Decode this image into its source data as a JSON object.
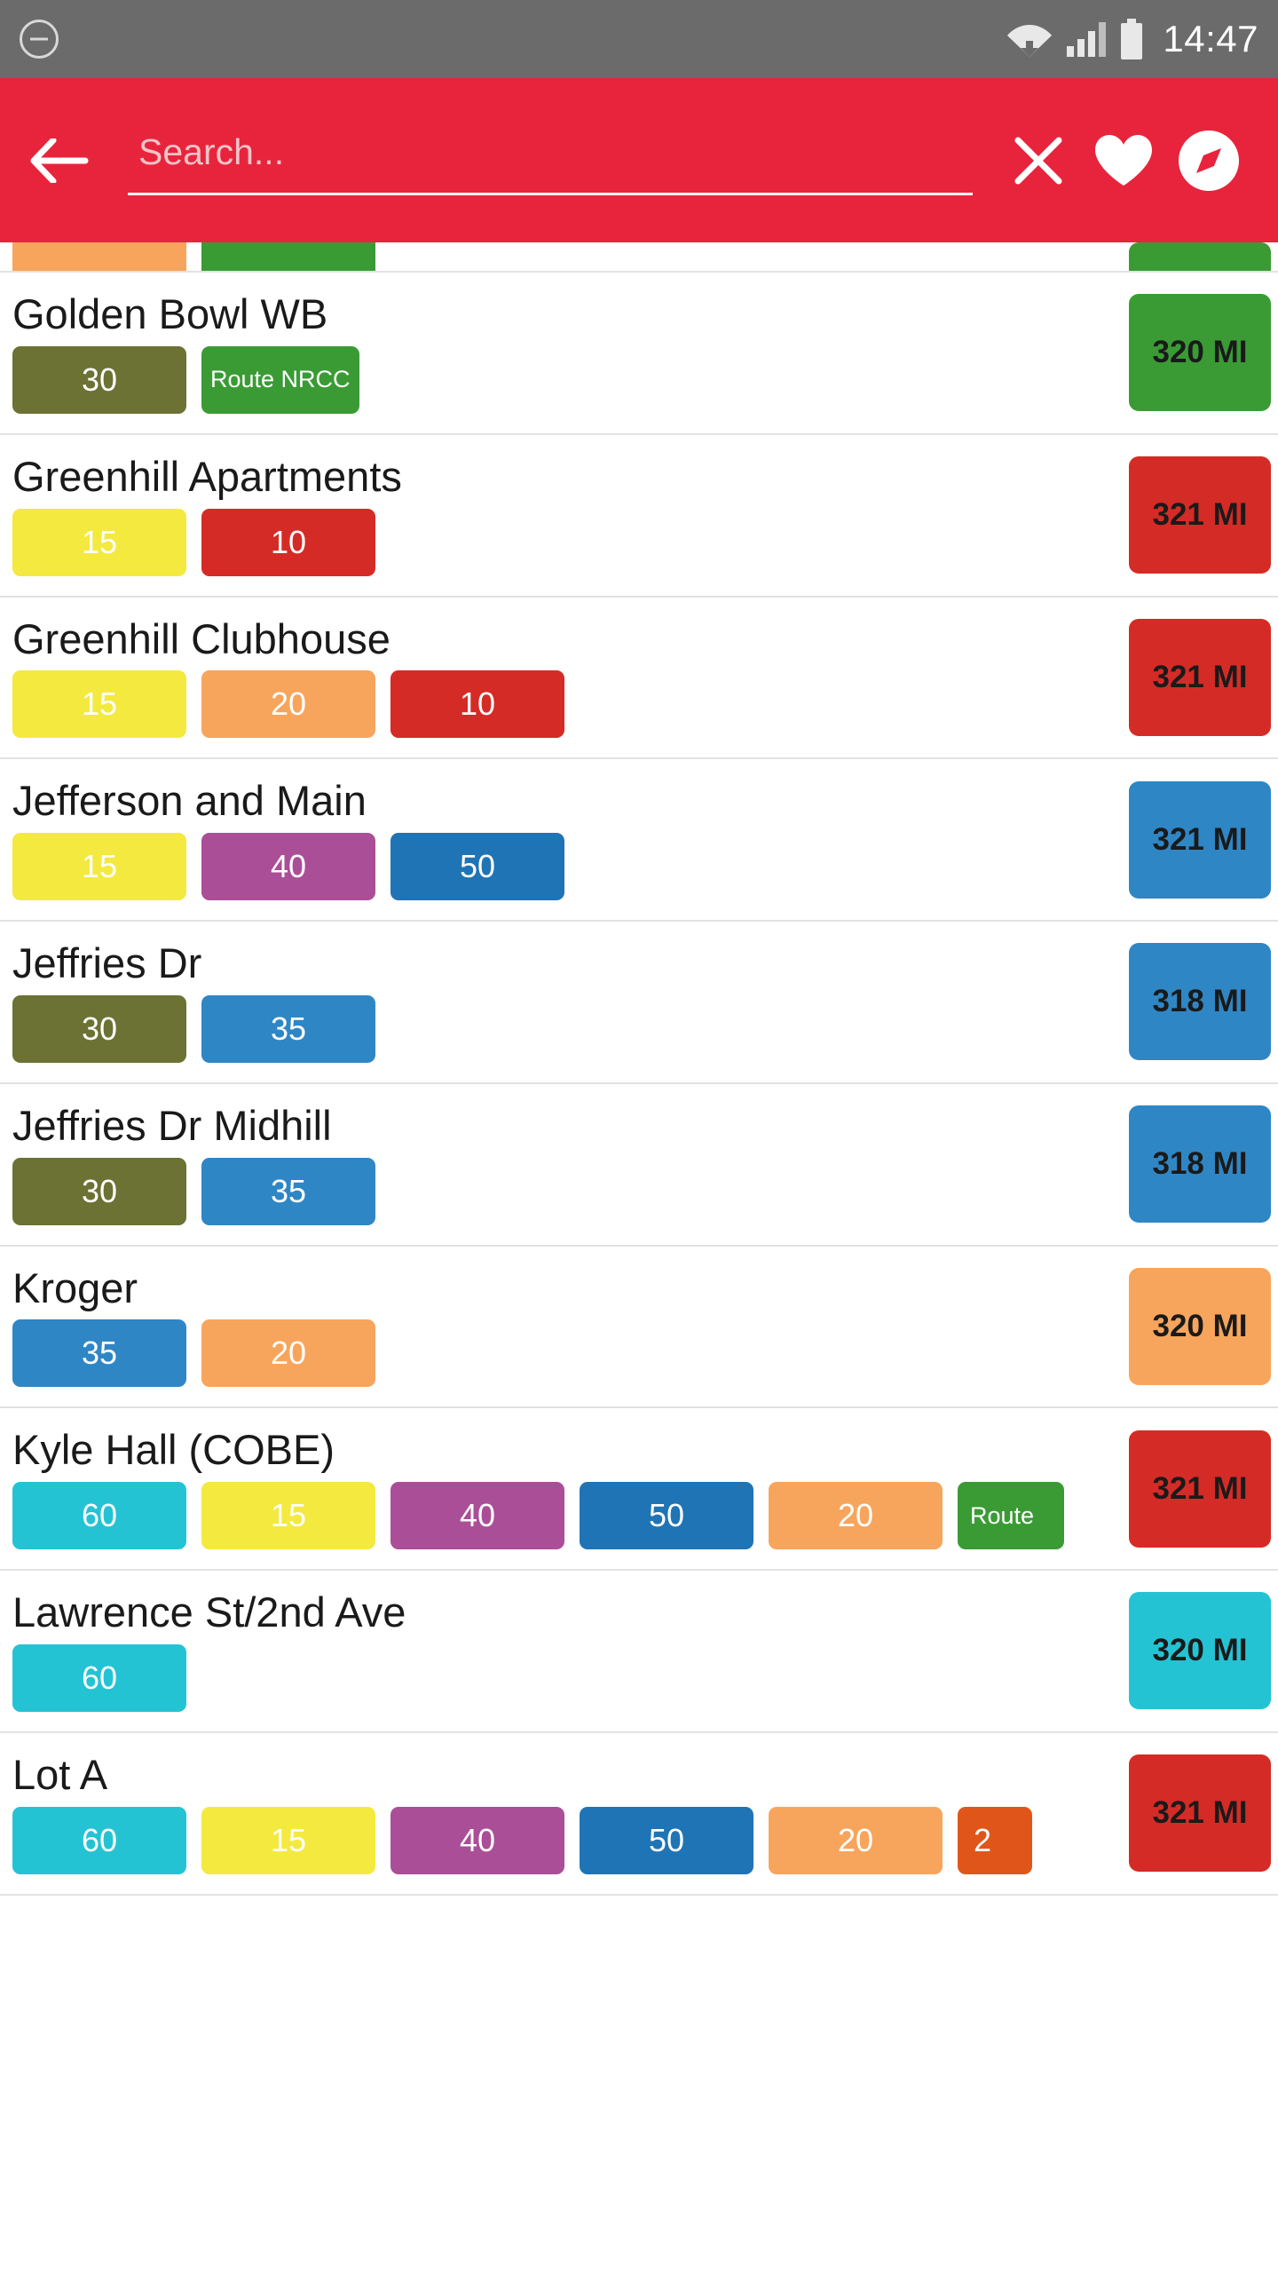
{
  "status_bar": {
    "time": "14:47",
    "icons": [
      "minus-circle-icon",
      "wifi-icon",
      "signal-icon",
      "battery-icon"
    ]
  },
  "app_bar": {
    "back_label": "back-arrow",
    "search_placeholder": "Search...",
    "search_value": "",
    "clear_label": "close-icon",
    "favorite_label": "heart-icon",
    "compass_label": "compass-icon",
    "background": "#e8243c"
  },
  "list": {
    "rows": [
      {
        "partial": true,
        "title": "",
        "chips": [
          {
            "label": "",
            "color": "#f7a55c"
          },
          {
            "label": "",
            "color": "#3a9b35"
          }
        ],
        "distance": {
          "label": "",
          "color": "#3a9b35"
        }
      },
      {
        "partial": false,
        "title": "Golden Bowl WB",
        "chips": [
          {
            "label": "30",
            "color": "#6b7233"
          },
          {
            "label": "Route NRCC",
            "color": "#3a9b35",
            "style": "route"
          }
        ],
        "distance": {
          "label": "320 MI",
          "color": "#3a9b35"
        }
      },
      {
        "partial": false,
        "title": "Greenhill Apartments",
        "chips": [
          {
            "label": "15",
            "color": "#f4e93f"
          },
          {
            "label": "10",
            "color": "#d52b26"
          }
        ],
        "distance": {
          "label": "321 MI",
          "color": "#d52b26"
        }
      },
      {
        "partial": false,
        "title": "Greenhill Clubhouse",
        "chips": [
          {
            "label": "15",
            "color": "#f4e93f"
          },
          {
            "label": "20",
            "color": "#f7a55c"
          },
          {
            "label": "10",
            "color": "#d52b26"
          }
        ],
        "distance": {
          "label": "321 MI",
          "color": "#d52b26"
        }
      },
      {
        "partial": false,
        "title": "Jefferson and Main",
        "chips": [
          {
            "label": "15",
            "color": "#f4e93f"
          },
          {
            "label": "40",
            "color": "#ab4e98"
          },
          {
            "label": "50",
            "color": "#1f74b5"
          }
        ],
        "distance": {
          "label": "321 MI",
          "color": "#2f86c5"
        }
      },
      {
        "partial": false,
        "title": "Jeffries Dr",
        "chips": [
          {
            "label": "30",
            "color": "#6b7233"
          },
          {
            "label": "35",
            "color": "#2f86c5"
          }
        ],
        "distance": {
          "label": "318 MI",
          "color": "#2f86c5"
        }
      },
      {
        "partial": false,
        "title": "Jeffries Dr Midhill",
        "chips": [
          {
            "label": "30",
            "color": "#6b7233"
          },
          {
            "label": "35",
            "color": "#2f86c5"
          }
        ],
        "distance": {
          "label": "318 MI",
          "color": "#2f86c5"
        }
      },
      {
        "partial": false,
        "title": "Kroger",
        "chips": [
          {
            "label": "35",
            "color": "#2f86c5"
          },
          {
            "label": "20",
            "color": "#f7a55c"
          }
        ],
        "distance": {
          "label": "320 MI",
          "color": "#f7a55c"
        }
      },
      {
        "partial": false,
        "title": "Kyle Hall (COBE)",
        "chips": [
          {
            "label": "60",
            "color": "#24c3d4"
          },
          {
            "label": "15",
            "color": "#f4e93f"
          },
          {
            "label": "40",
            "color": "#ab4e98"
          },
          {
            "label": "50",
            "color": "#1f74b5"
          },
          {
            "label": "20",
            "color": "#f7a55c"
          },
          {
            "label": "Route",
            "color": "#3a9b35",
            "style": "clipped-route"
          }
        ],
        "distance": {
          "label": "321 MI",
          "color": "#d52b26"
        }
      },
      {
        "partial": false,
        "title": "Lawrence St/2nd Ave",
        "chips": [
          {
            "label": "60",
            "color": "#24c3d4"
          }
        ],
        "distance": {
          "label": "320 MI",
          "color": "#24c3d4"
        }
      },
      {
        "partial": false,
        "title": "Lot A",
        "chips": [
          {
            "label": "60",
            "color": "#24c3d4"
          },
          {
            "label": "15",
            "color": "#f4e93f"
          },
          {
            "label": "40",
            "color": "#ab4e98"
          },
          {
            "label": "50",
            "color": "#1f74b5"
          },
          {
            "label": "20",
            "color": "#f7a55c"
          },
          {
            "label": "2",
            "color": "#e0561a",
            "style": "clipped"
          }
        ],
        "distance": {
          "label": "321 MI",
          "color": "#d52b26"
        }
      }
    ]
  }
}
